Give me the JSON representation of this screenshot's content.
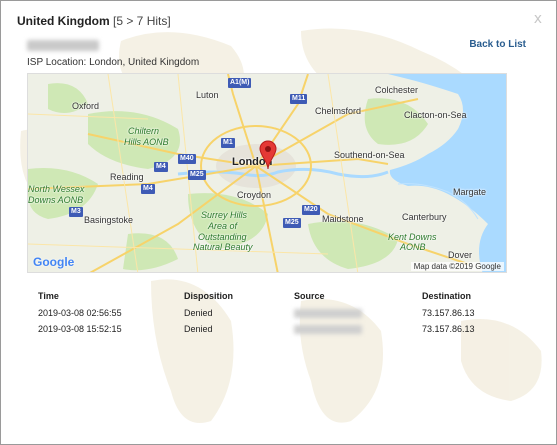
{
  "dialog": {
    "country": "United Kingdom",
    "hits": "[5 > 7 Hits]",
    "close_glyph": "x",
    "back_label": "Back to List",
    "isp_location": "ISP Location: London, United Kingdom"
  },
  "map": {
    "labels": {
      "luton": "Luton",
      "oxford": "Oxford",
      "chelmsford": "Chelmsford",
      "colchester": "Colchester",
      "clacton": "Clacton-on-Sea",
      "chiltern": "Chiltern",
      "hills_aonb": "Hills AONB",
      "london": "London",
      "southend": "Southend-on-Sea",
      "reading": "Reading",
      "north_wessex": "North Wessex",
      "downs_aonb": "Downs AONB",
      "croydon": "Croydon",
      "margate": "Margate",
      "basingstoke": "Basingstoke",
      "surrey_hills": "Surrey Hills",
      "area_of": "Area of",
      "outstanding": "Outstanding",
      "natural_beauty": "Natural Beauty",
      "maidstone": "Maidstone",
      "canterbury": "Canterbury",
      "kent_downs": "Kent Downs",
      "aonb": "AONB",
      "dover": "Dover"
    },
    "roads": {
      "a1m": "A1(M)",
      "m11": "M11",
      "m1": "M1",
      "m40": "M40",
      "m4a": "M4",
      "m4b": "M4",
      "m25a": "M25",
      "m25b": "M25",
      "m20": "M20",
      "m3": "M3"
    },
    "google": "Google",
    "attribution": "Map data ©2019 Google",
    "colors": {
      "land": "#eef0e6",
      "sea": "#aadaff",
      "green": "#cfe8b5",
      "road": "#f7d36a",
      "pin": "#e53935"
    }
  },
  "table": {
    "headers": {
      "time": "Time",
      "disposition": "Disposition",
      "source": "Source",
      "destination": "Destination"
    },
    "rows": [
      {
        "time": "2019-03-08 02:56:55",
        "disposition": "Denied",
        "destination": "73.157.86.13"
      },
      {
        "time": "2019-03-08 15:52:15",
        "disposition": "Denied",
        "destination": "73.157.86.13"
      }
    ]
  }
}
